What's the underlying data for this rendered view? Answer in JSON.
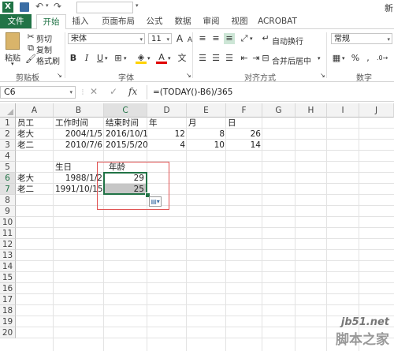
{
  "titlebar": {
    "app_glyph": "X",
    "right_text": "新"
  },
  "tabs": [
    "文件",
    "开始",
    "插入",
    "页面布局",
    "公式",
    "数据",
    "审阅",
    "视图",
    "ACROBAT"
  ],
  "ribbon": {
    "clipboard": {
      "paste": "粘贴",
      "cut": "剪切",
      "copy": "复制",
      "format_painter": "格式刷",
      "label": "剪贴板"
    },
    "font": {
      "name": "宋体",
      "size": "11",
      "label": "字体",
      "bold": "B",
      "italic": "I",
      "underline": "U",
      "grow": "A",
      "shrink": "A",
      "color_a": "A"
    },
    "alignment": {
      "wrap": "自动换行",
      "merge": "合并后居中",
      "label": "对齐方式"
    },
    "number": {
      "format": "常规",
      "percent": "%",
      "comma": ",",
      "label": "数字"
    }
  },
  "formula_bar": {
    "name_box": "C6",
    "cancel": "✕",
    "enter": "✓",
    "fx": "fx",
    "formula": "=(TODAY()-B6)/365"
  },
  "columns": [
    "A",
    "B",
    "C",
    "D",
    "E",
    "F",
    "G",
    "H",
    "I",
    "J"
  ],
  "rows": [
    "1",
    "2",
    "3",
    "4",
    "5",
    "6",
    "7",
    "8",
    "9",
    "10",
    "11",
    "12",
    "13",
    "14",
    "15",
    "16",
    "17",
    "18",
    "19",
    "20"
  ],
  "cells": {
    "A1": "员工",
    "B1": "工作时间",
    "C1": "结束时间",
    "D1": "年",
    "E1": "月",
    "F1": "日",
    "A2": "老大",
    "B2": "2004/1/5",
    "C2": "2016/10/1",
    "D2": "12",
    "E2": "8",
    "F2": "26",
    "A3": "老二",
    "B3": "2010/7/6",
    "C3": "2015/5/20",
    "D3": "4",
    "E3": "10",
    "F3": "14",
    "B5": "生日",
    "C5": "年龄",
    "A6": "老大",
    "B6": "1988/1/2",
    "C6": "29",
    "A7": "老二",
    "B7": "1991/10/15",
    "C7": "25"
  },
  "watermark": {
    "line1": "jb51.net",
    "line2": "脚本之家"
  },
  "colors": {
    "accent": "#217346",
    "annotation": "#e05050"
  }
}
